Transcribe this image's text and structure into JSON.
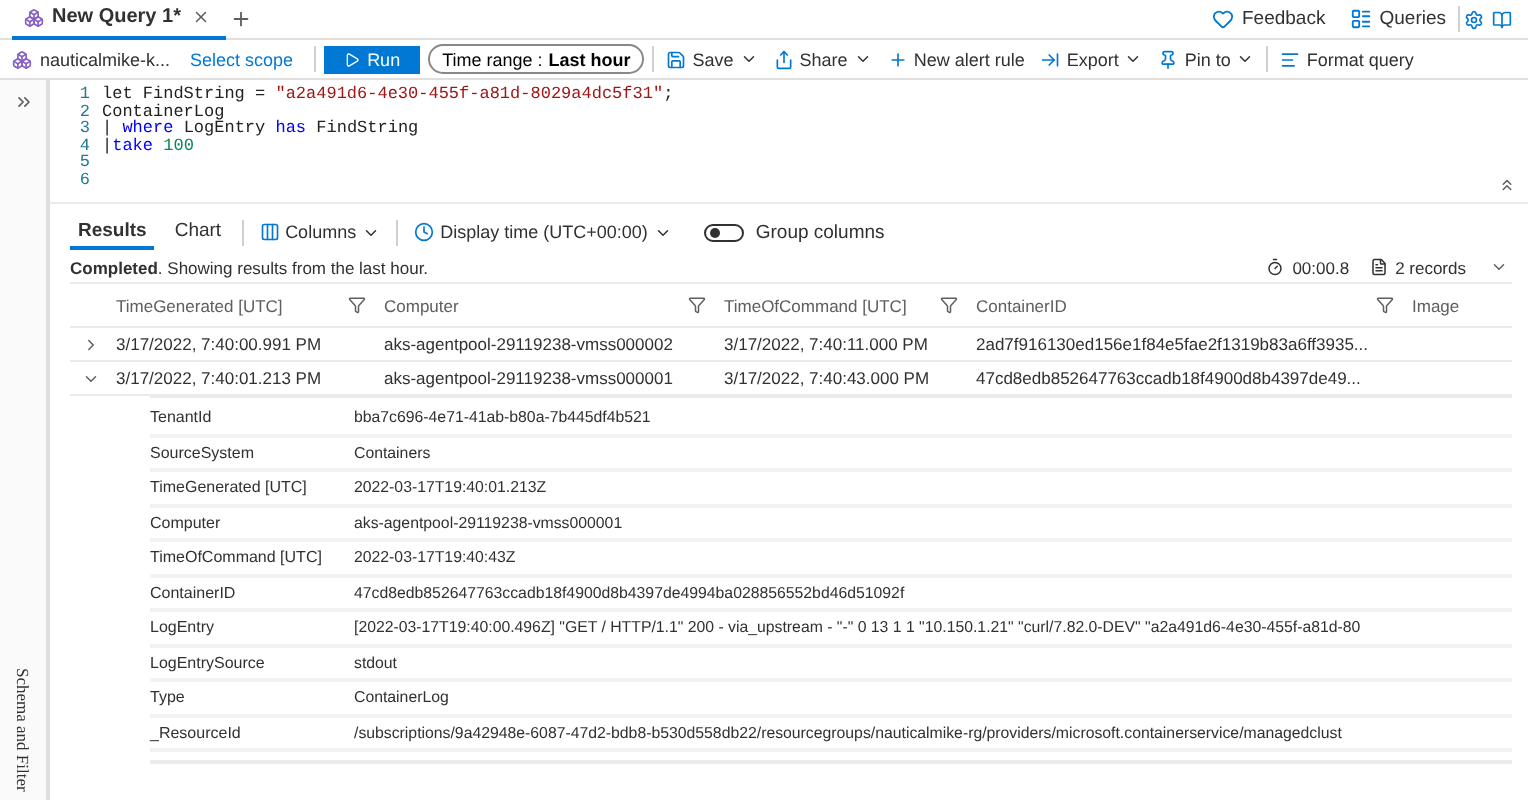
{
  "tab": {
    "title": "New Query 1*"
  },
  "header_links": [
    {
      "label": "Feedback",
      "kind": "feedback"
    },
    {
      "label": "Queries",
      "kind": "queries"
    }
  ],
  "toolbar": {
    "scope": "nauticalmike-k...",
    "select_scope": "Select scope",
    "run": "Run",
    "time_range_label": "Time range :",
    "time_range_value": "Last hour",
    "actions": [
      {
        "label": "Save",
        "kind": "save",
        "dropdown": true
      },
      {
        "label": "Share",
        "kind": "share",
        "dropdown": true
      },
      {
        "label": "New alert rule",
        "kind": "alert",
        "dropdown": false
      },
      {
        "label": "Export",
        "kind": "export",
        "dropdown": true
      },
      {
        "label": "Pin to",
        "kind": "pin",
        "dropdown": true
      },
      {
        "label": "Format query",
        "kind": "format",
        "dropdown": false
      }
    ]
  },
  "editor": {
    "lines": [
      {
        "number": "1",
        "tokens": [
          {
            "text": "let FindString = ",
            "kind": "plain"
          },
          {
            "text": "\"a2a491d6-4e30-455f-a81d-8029a4dc5f31\"",
            "kind": "string"
          },
          {
            "text": ";",
            "kind": "plain"
          }
        ]
      },
      {
        "number": "2",
        "tokens": [
          {
            "text": "ContainerLog",
            "kind": "plain"
          }
        ]
      },
      {
        "number": "3",
        "tokens": [
          {
            "text": "| ",
            "kind": "plain"
          },
          {
            "text": "where",
            "kind": "keyword"
          },
          {
            "text": " LogEntry ",
            "kind": "plain"
          },
          {
            "text": "has",
            "kind": "keyword"
          },
          {
            "text": " FindString",
            "kind": "plain"
          }
        ]
      },
      {
        "number": "4",
        "tokens": [
          {
            "text": "|",
            "kind": "plain"
          },
          {
            "text": "take",
            "kind": "keyword"
          },
          {
            "text": " 100",
            "kind": "number"
          }
        ]
      },
      {
        "number": "5"
      },
      {
        "number": "6"
      }
    ]
  },
  "results": {
    "tabs": [
      {
        "label": "Results",
        "selected": true
      },
      {
        "label": "Chart",
        "selected": false
      }
    ],
    "columns_button": "Columns",
    "display_time": "Display time (UTC+00:00)",
    "group_columns": {
      "label": "Group columns",
      "on": false
    },
    "status": "**Completed**. Showing results from the last hour.",
    "duration": "00:00.8",
    "records": "2 records"
  },
  "table": {
    "columns": [
      "TimeGenerated [UTC]",
      "Computer",
      "TimeOfCommand [UTC]",
      "ContainerID",
      "Image"
    ],
    "rows": [
      {
        "expanded": false,
        "cells": [
          "3/17/2022, 7:40:00.991 PM",
          "aks-agentpool-29119238-vmss000002",
          "3/17/2022, 7:40:11.000 PM",
          "2ad7f916130ed156e1f84e5fae2f1319b83a6ff3935..."
        ]
      },
      {
        "expanded": true,
        "cells": [
          "3/17/2022, 7:40:01.213 PM",
          "aks-agentpool-29119238-vmss000001",
          "3/17/2022, 7:40:43.000 PM",
          "47cd8edb852647763ccadb18f4900d8b4397de49..."
        ],
        "details": [
          {
            "key": "TenantId",
            "value": "bba7c696-4e71-41ab-b80a-7b445df4b521"
          },
          {
            "key": "SourceSystem",
            "value": "Containers"
          },
          {
            "key": "TimeGenerated [UTC]",
            "value": "2022-03-17T19:40:01.213Z"
          },
          {
            "key": "Computer",
            "value": "aks-agentpool-29119238-vmss000001"
          },
          {
            "key": "TimeOfCommand [UTC]",
            "value": "2022-03-17T19:40:43Z"
          },
          {
            "key": "ContainerID",
            "value": "47cd8edb852647763ccadb18f4900d8b4397de4994ba028856552bd46d51092f"
          },
          {
            "key": "LogEntry",
            "value": "[2022-03-17T19:40:00.496Z] \"GET / HTTP/1.1\" 200 - via_upstream - \"-\" 0 13 1 1 \"10.150.1.21\" \"curl/7.82.0-DEV\" \"a2a491d6-4e30-455f-a81d-80"
          },
          {
            "key": "LogEntrySource",
            "value": "stdout"
          },
          {
            "key": "Type",
            "value": "ContainerLog"
          },
          {
            "key": "_ResourceId",
            "value": "/subscriptions/9a42948e-6087-47d2-bdb8-b530d558db22/resourcegroups/nauticalmike-rg/providers/microsoft.containerservice/managedclust"
          }
        ]
      }
    ]
  },
  "sidebar": {
    "label": "Schema and Filter"
  }
}
